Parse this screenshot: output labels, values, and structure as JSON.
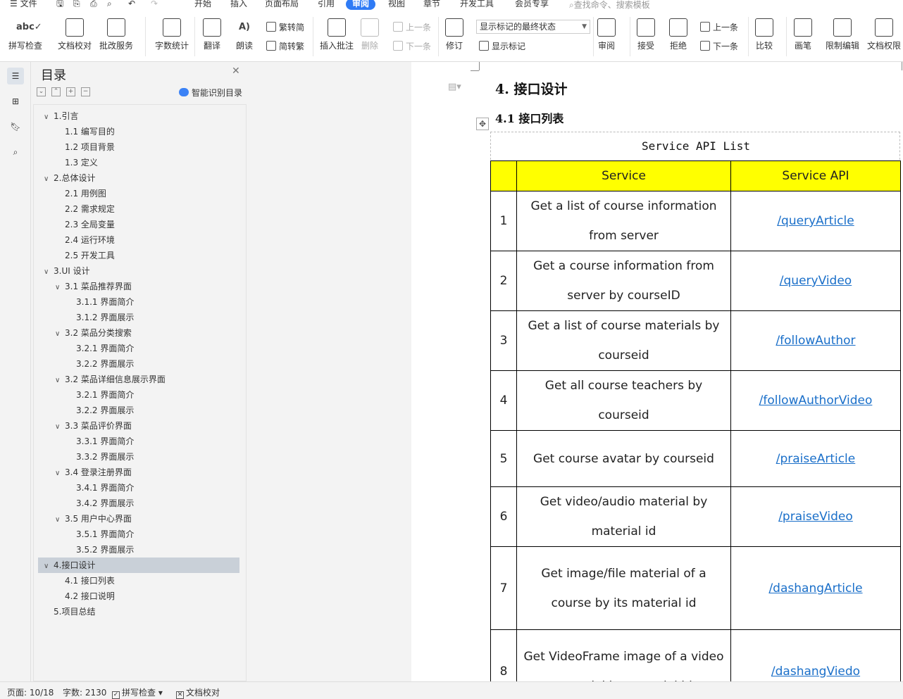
{
  "menubar": {
    "file": "文件",
    "tabs": [
      "开始",
      "插入",
      "页面布局",
      "引用",
      "审阅",
      "视图",
      "章节",
      "开发工具",
      "会员专享"
    ],
    "active_tab": "审阅",
    "search_placeholder": "查找命令、搜索模板"
  },
  "ribbon": {
    "spell_check": "拼写检查",
    "doc_proofread": "文档校对",
    "batch_service": "批改服务",
    "word_count": "字数统计",
    "translate": "翻译",
    "read_aloud": "朗读",
    "trad_to_simp": "繁转简",
    "simp_to_trad": "简转繁",
    "insert_comment": "插入批注",
    "delete": "删除",
    "prev_comment": "上一条",
    "next_comment": "下一条",
    "track_changes": "修订",
    "display_state": "显示标记的最终状态",
    "show_markup": "显示标记",
    "review": "审阅",
    "accept": "接受",
    "reject": "拒绝",
    "prev_change": "上一条",
    "next_change": "下一条",
    "compare": "比较",
    "pen": "画笔",
    "restrict_edit": "限制编辑",
    "doc_permission": "文档权限"
  },
  "toc": {
    "title": "目录",
    "ai_label": "智能识别目录",
    "items": [
      {
        "text": "1.引言",
        "level": 1,
        "arrow": true
      },
      {
        "text": "1.1 编写目的",
        "level": 2,
        "arrow": false
      },
      {
        "text": "1.2 项目背景",
        "level": 2,
        "arrow": false
      },
      {
        "text": "1.3 定义",
        "level": 2,
        "arrow": false
      },
      {
        "text": "2.总体设计",
        "level": 1,
        "arrow": true
      },
      {
        "text": "2.1 用例图",
        "level": 2,
        "arrow": false
      },
      {
        "text": "2.2 需求规定",
        "level": 2,
        "arrow": false
      },
      {
        "text": "2.3 全局变量",
        "level": 2,
        "arrow": false
      },
      {
        "text": "2.4 运行环境",
        "level": 2,
        "arrow": false
      },
      {
        "text": "2.5 开发工具",
        "level": 2,
        "arrow": false
      },
      {
        "text": "3.UI 设计",
        "level": 1,
        "arrow": true
      },
      {
        "text": "3.1 菜品推荐界面",
        "level": 2,
        "arrow": true
      },
      {
        "text": "3.1.1 界面简介",
        "level": 3,
        "arrow": false
      },
      {
        "text": "3.1.2 界面展示",
        "level": 3,
        "arrow": false
      },
      {
        "text": "3.2 菜品分类搜索",
        "level": 2,
        "arrow": true
      },
      {
        "text": "3.2.1 界面简介",
        "level": 3,
        "arrow": false
      },
      {
        "text": "3.2.2 界面展示",
        "level": 3,
        "arrow": false
      },
      {
        "text": "3.2 菜品详细信息展示界面",
        "level": 2,
        "arrow": true
      },
      {
        "text": "3.2.1 界面简介",
        "level": 3,
        "arrow": false
      },
      {
        "text": "3.2.2 界面展示",
        "level": 3,
        "arrow": false
      },
      {
        "text": "3.3 菜品评价界面",
        "level": 2,
        "arrow": true
      },
      {
        "text": "3.3.1 界面简介",
        "level": 3,
        "arrow": false
      },
      {
        "text": "3.3.2 界面展示",
        "level": 3,
        "arrow": false
      },
      {
        "text": "3.4 登录注册界面",
        "level": 2,
        "arrow": true
      },
      {
        "text": "3.4.1 界面简介",
        "level": 3,
        "arrow": false
      },
      {
        "text": "3.4.2 界面展示",
        "level": 3,
        "arrow": false
      },
      {
        "text": "3.5 用户中心界面",
        "level": 2,
        "arrow": true
      },
      {
        "text": "3.5.1 界面简介",
        "level": 3,
        "arrow": false
      },
      {
        "text": "3.5.2 界面展示",
        "level": 3,
        "arrow": false
      },
      {
        "text": "4.接口设计",
        "level": 1,
        "arrow": true,
        "selected": true
      },
      {
        "text": "4.1 接口列表",
        "level": 2,
        "arrow": false
      },
      {
        "text": "4.2 接口说明",
        "level": 2,
        "arrow": false
      },
      {
        "text": "5.项目总结",
        "level": 1,
        "arrow": false
      }
    ]
  },
  "document": {
    "heading1": "4. 接口设计",
    "heading2": "4.1 接口列表",
    "caption": "Service API List",
    "table": {
      "headers": [
        "",
        "Service",
        "Service API"
      ],
      "rows": [
        {
          "no": "1",
          "service": "Get a list of course information from server",
          "api": "/queryArticle"
        },
        {
          "no": "2",
          "service": "Get a course information from server by courseID",
          "api": "/queryVideo"
        },
        {
          "no": "3",
          "service": "Get a list of course materials by courseid",
          "api": "/followAuthor"
        },
        {
          "no": "4",
          "service": "Get all course teachers by courseid",
          "api": "/followAuthorVideo"
        },
        {
          "no": "5",
          "service": "Get course avatar by courseid",
          "api": "/praiseArticle"
        },
        {
          "no": "6",
          "service": "Get video/audio material by material id",
          "api": "/praiseVideo"
        },
        {
          "no": "7",
          "service": "Get image/file material of a course by its material id",
          "api": "/dashangArticle"
        },
        {
          "no": "8",
          "service": "Get VideoFrame image of a video material by material id",
          "api": "/dashangViedo"
        }
      ]
    }
  },
  "status": {
    "page": "页面: 10/18",
    "words": "字数: 2130",
    "spell_check": "拼写检查",
    "doc_proofread": "文档校对"
  },
  "colors": {
    "accent": "#2f7bf5",
    "table_header": "#ffff00",
    "link": "#1a6fc9"
  }
}
